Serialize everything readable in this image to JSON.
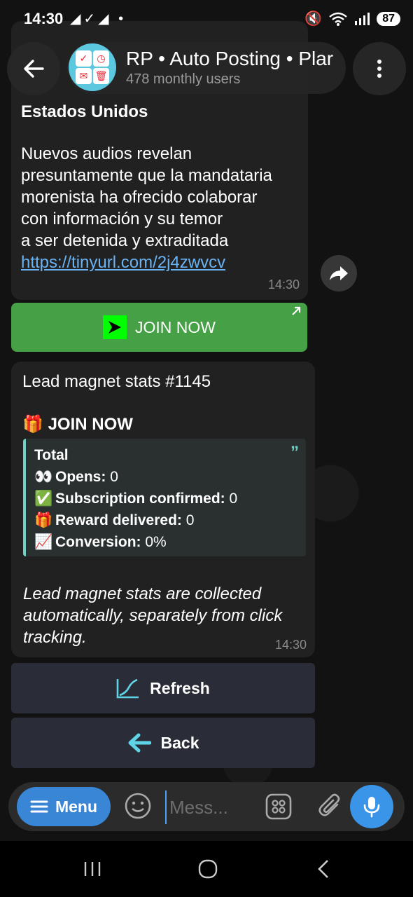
{
  "status_bar": {
    "time": "14:30",
    "left_icons": "◢✓◢ •",
    "battery": "87"
  },
  "header": {
    "title": "RP • Auto Posting • Plar",
    "subtitle": "478 monthly users",
    "icons": [
      "back-arrow-icon",
      "channel-avatar",
      "more-vertical-icon"
    ]
  },
  "message1": {
    "heading": "Estados Unidos",
    "body": [
      "Nuevos audios revelan",
      "presuntamente que la mandataria",
      "morenista ha ofrecido colaborar",
      "con información y su temor",
      "a ser detenida y extraditada"
    ],
    "link": "https://tinyurl.com/2j4zwvcv",
    "time": "14:30"
  },
  "join_button": {
    "label": "JOIN NOW"
  },
  "message2": {
    "title": "Lead magnet stats #1145",
    "join_line": "JOIN NOW",
    "quote": {
      "total": "Total",
      "opens_label": "Opens:",
      "opens_value": "0",
      "subs_label": "Subscription confirmed:",
      "subs_value": "0",
      "reward_label": "Reward delivered:",
      "reward_value": "0",
      "conversion_label": "Conversion:",
      "conversion_value": "0%"
    },
    "italic_note": "Lead magnet stats are collected automatically, separately from click tracking.",
    "time": "14:30"
  },
  "inline_buttons": {
    "refresh": "Refresh",
    "back": "Back"
  },
  "composer": {
    "menu_label": "Menu",
    "placeholder": "Mess..."
  },
  "colors": {
    "accent": "#3a86d6",
    "join_green": "#46a146",
    "quote_teal": "#6fd2c4"
  }
}
